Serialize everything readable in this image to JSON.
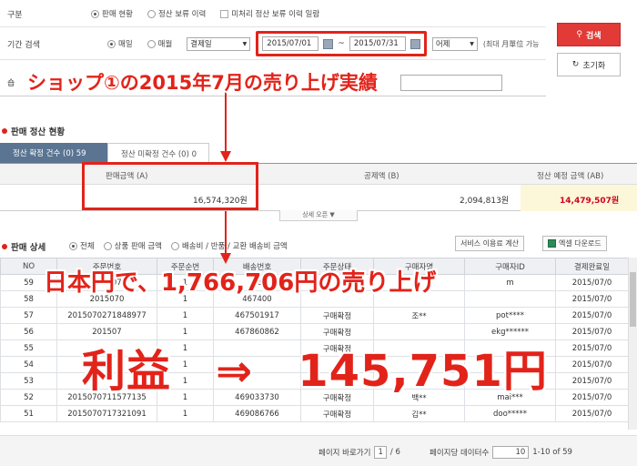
{
  "filters": {
    "category": {
      "label": "구분",
      "options": [
        {
          "label": "판매 현황",
          "selected": true
        },
        {
          "label": "정산 보류 이력",
          "selected": false
        },
        {
          "label": "미처리 정산 보류 이력 일람",
          "selected": false,
          "type": "checkbox"
        }
      ]
    },
    "period": {
      "label": "기간 검색",
      "daily_label": "매일",
      "monthly_label": "매월",
      "date_type": "결제일",
      "start_date": "2015/07/01",
      "range_separator": "~",
      "end_date": "2015/07/31",
      "preset": "어제",
      "note": "(최대 月單位 가능"
    },
    "shop_label": "숍"
  },
  "buttons": {
    "search": "검색",
    "reset": "초기화",
    "service_fee": "서비스 이용료 계산",
    "excel_download": "엑셀 다운로드"
  },
  "annotations": {
    "shop_summary": "ショップ①の2015年7月の売り上げ実績",
    "yen_sales": "日本円で、1,766,706円の売り上げ",
    "profit": "利益　⇒　145,751円"
  },
  "summary": {
    "section_title": "판매 정산 현황",
    "tabs": {
      "settled": "정산 확정 건수 (0) 59",
      "unsettled": "정산 미확정 건수 (0) 0"
    },
    "headers": {
      "sales": "판매금액 (A)",
      "deduction": "공제액 (B)",
      "expected": "정산 예정 금액 (AB)"
    },
    "values": {
      "sales": "16,574,320원",
      "deduction": "2,094,813원",
      "expected": "14,479,507원"
    },
    "detail_toggle": "상세 오픈 ▼"
  },
  "detail": {
    "section_title": "판매 상세",
    "options": [
      {
        "label": "전체",
        "selected": true
      },
      {
        "label": "상품 판매 금액",
        "selected": false
      },
      {
        "label": "배송비 / 반품 / 교환 배송비 금액",
        "selected": false
      }
    ]
  },
  "table": {
    "columns": [
      "NO",
      "주문번호",
      "주문순번",
      "배송번호",
      "주문상태",
      "구매자명",
      "구매자ID",
      "결제완료일"
    ],
    "rows": [
      [
        "59",
        "201507",
        "1",
        "46",
        "",
        "",
        "m",
        "2015/07/0"
      ],
      [
        "58",
        "2015070",
        "1",
        "467400",
        "",
        "",
        "",
        "2015/07/0"
      ],
      [
        "57",
        "2015070271848977",
        "1",
        "467501917",
        "구매확정",
        "조**",
        "pot****",
        "2015/07/0"
      ],
      [
        "56",
        "201507",
        "1",
        "467860862",
        "구매확정",
        "",
        "ekg******",
        "2015/07/0"
      ],
      [
        "55",
        "",
        "1",
        "",
        "구매확정",
        "",
        "",
        "2015/07/0"
      ],
      [
        "54",
        "",
        "1",
        "",
        "",
        "",
        "",
        "2015/07/0"
      ],
      [
        "53",
        "",
        "1",
        "",
        "",
        "",
        "",
        "2015/07/0"
      ],
      [
        "52",
        "2015070711577135",
        "1",
        "469033730",
        "구매확정",
        "백**",
        "mai***",
        "2015/07/0"
      ],
      [
        "51",
        "2015070717321091",
        "1",
        "469086766",
        "구매확정",
        "김**",
        "doo*****",
        "2015/07/0"
      ]
    ]
  },
  "pagination": {
    "goto_label": "페이지 바로가기",
    "page": "1",
    "total_pages": "/ 6",
    "per_page_label": "페이지당 데이터수",
    "per_page": "10",
    "range": "1-10 of 59"
  },
  "colors": {
    "accent_red": "#e2231a",
    "tab_active": "#5a7492",
    "expected_bg": "#fdf7d9"
  }
}
